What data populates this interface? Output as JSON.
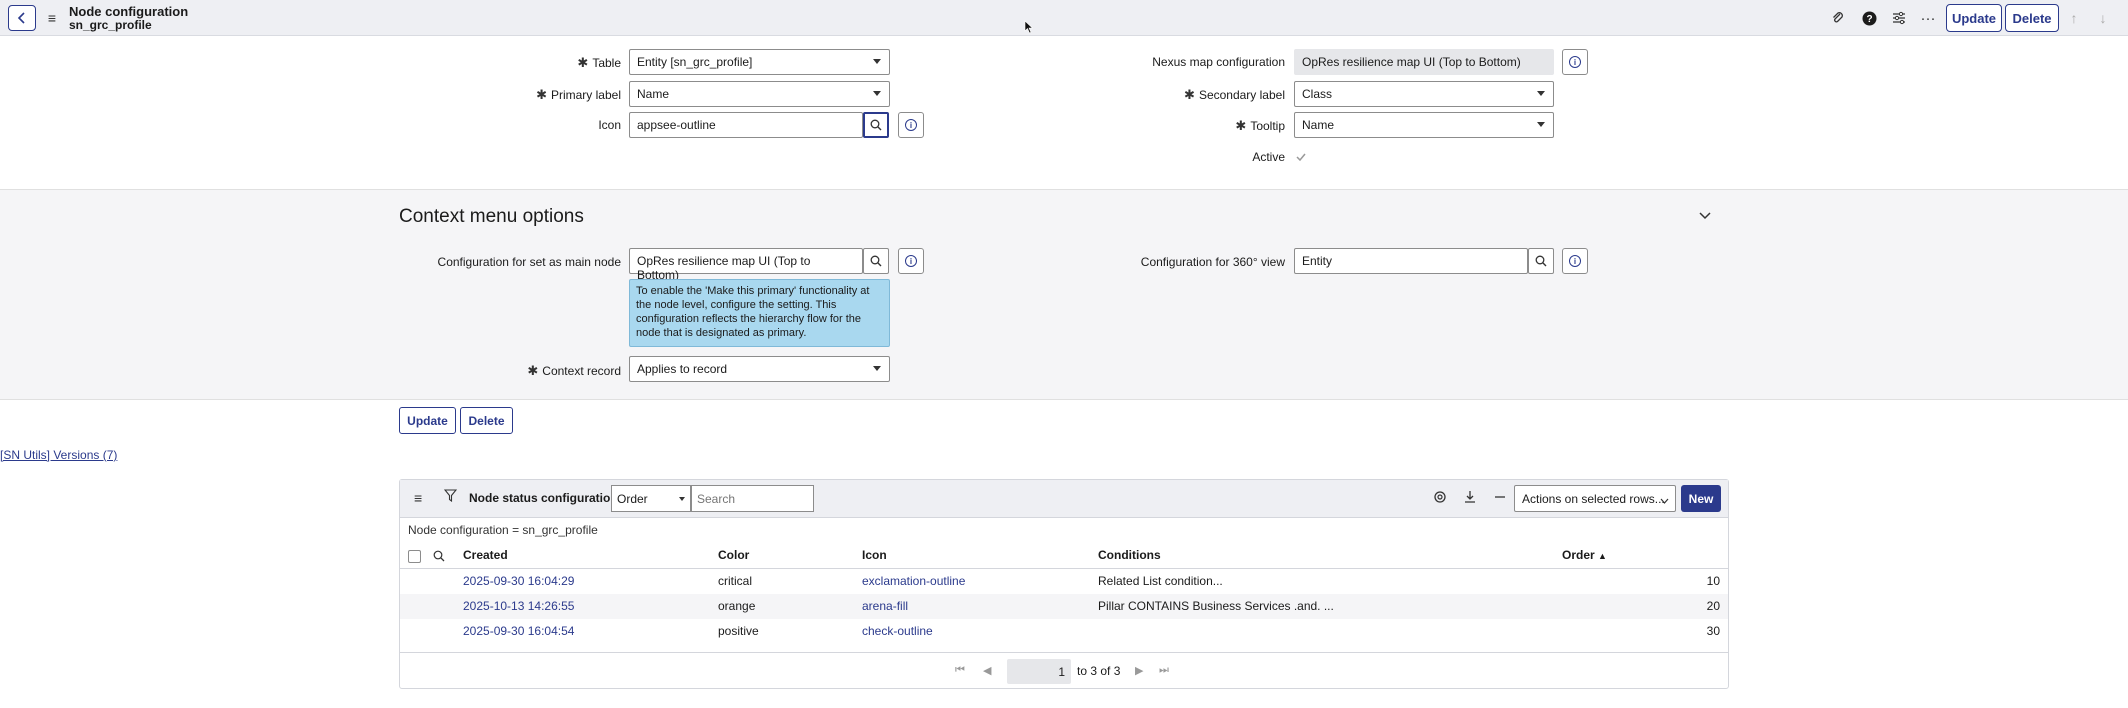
{
  "header": {
    "title": "Node configuration",
    "subtitle": "sn_grc_profile",
    "buttons": {
      "update": "Update",
      "delete": "Delete"
    },
    "icons": [
      "back-icon",
      "menu-icon",
      "paperclip-icon",
      "help-icon",
      "settings-sliders-icon",
      "more-icon",
      "up-arrow-icon",
      "down-arrow-icon"
    ]
  },
  "form": {
    "table": {
      "label": "Table",
      "value": "Entity [sn_grc_profile]"
    },
    "primary_label": {
      "label": "Primary label",
      "value": "Name"
    },
    "icon": {
      "label": "Icon",
      "value": "appsee-outline"
    },
    "nexus_map": {
      "label": "Nexus map configuration",
      "value": "OpRes resilience map UI (Top to Bottom)"
    },
    "secondary_label": {
      "label": "Secondary label",
      "value": "Class"
    },
    "tooltip": {
      "label": "Tooltip",
      "value": "Name"
    },
    "active": {
      "label": "Active",
      "checked": true
    }
  },
  "context": {
    "title": "Context menu options",
    "main_node": {
      "label": "Configuration for set as main node",
      "value": "OpRes resilience map UI (Top to Bottom)"
    },
    "help_text": "To enable the 'Make this primary' functionality at the node level, configure the setting. This configuration reflects the hierarchy flow for the node that is designated as primary.",
    "view360": {
      "label": "Configuration for 360° view",
      "value": "Entity"
    },
    "context_record": {
      "label": "Context record",
      "value": "Applies to record"
    }
  },
  "form_buttons": {
    "update": "Update",
    "delete": "Delete"
  },
  "snutils_link": "[SN Utils] Versions (7)",
  "related_list": {
    "title": "Node status configurations",
    "order_select": "Order",
    "search_placeholder": "Search",
    "actions": "Actions on selected rows...",
    "new_label": "New",
    "breadcrumb": "Node configuration = sn_grc_profile",
    "columns": {
      "created": "Created",
      "color": "Color",
      "icon": "Icon",
      "conditions": "Conditions",
      "order": "Order"
    },
    "rows": [
      {
        "created": "2025-09-30 16:04:29",
        "color": "critical",
        "icon": "exclamation-outline",
        "conditions": "Related List condition...",
        "order": "10"
      },
      {
        "created": "2025-10-13 14:26:55",
        "color": "orange",
        "icon": "arena-fill",
        "conditions": "Pillar CONTAINS Business Services .and. ...",
        "order": "20"
      },
      {
        "created": "2025-09-30 16:04:54",
        "color": "positive",
        "icon": "check-outline",
        "conditions": "",
        "order": "30"
      }
    ],
    "pager": {
      "page": "1",
      "range": "to 3 of 3"
    }
  },
  "colors": {
    "accent": "#2b3a8c",
    "help_bg": "#a9d8ef",
    "header_bg": "#eeeff3"
  }
}
